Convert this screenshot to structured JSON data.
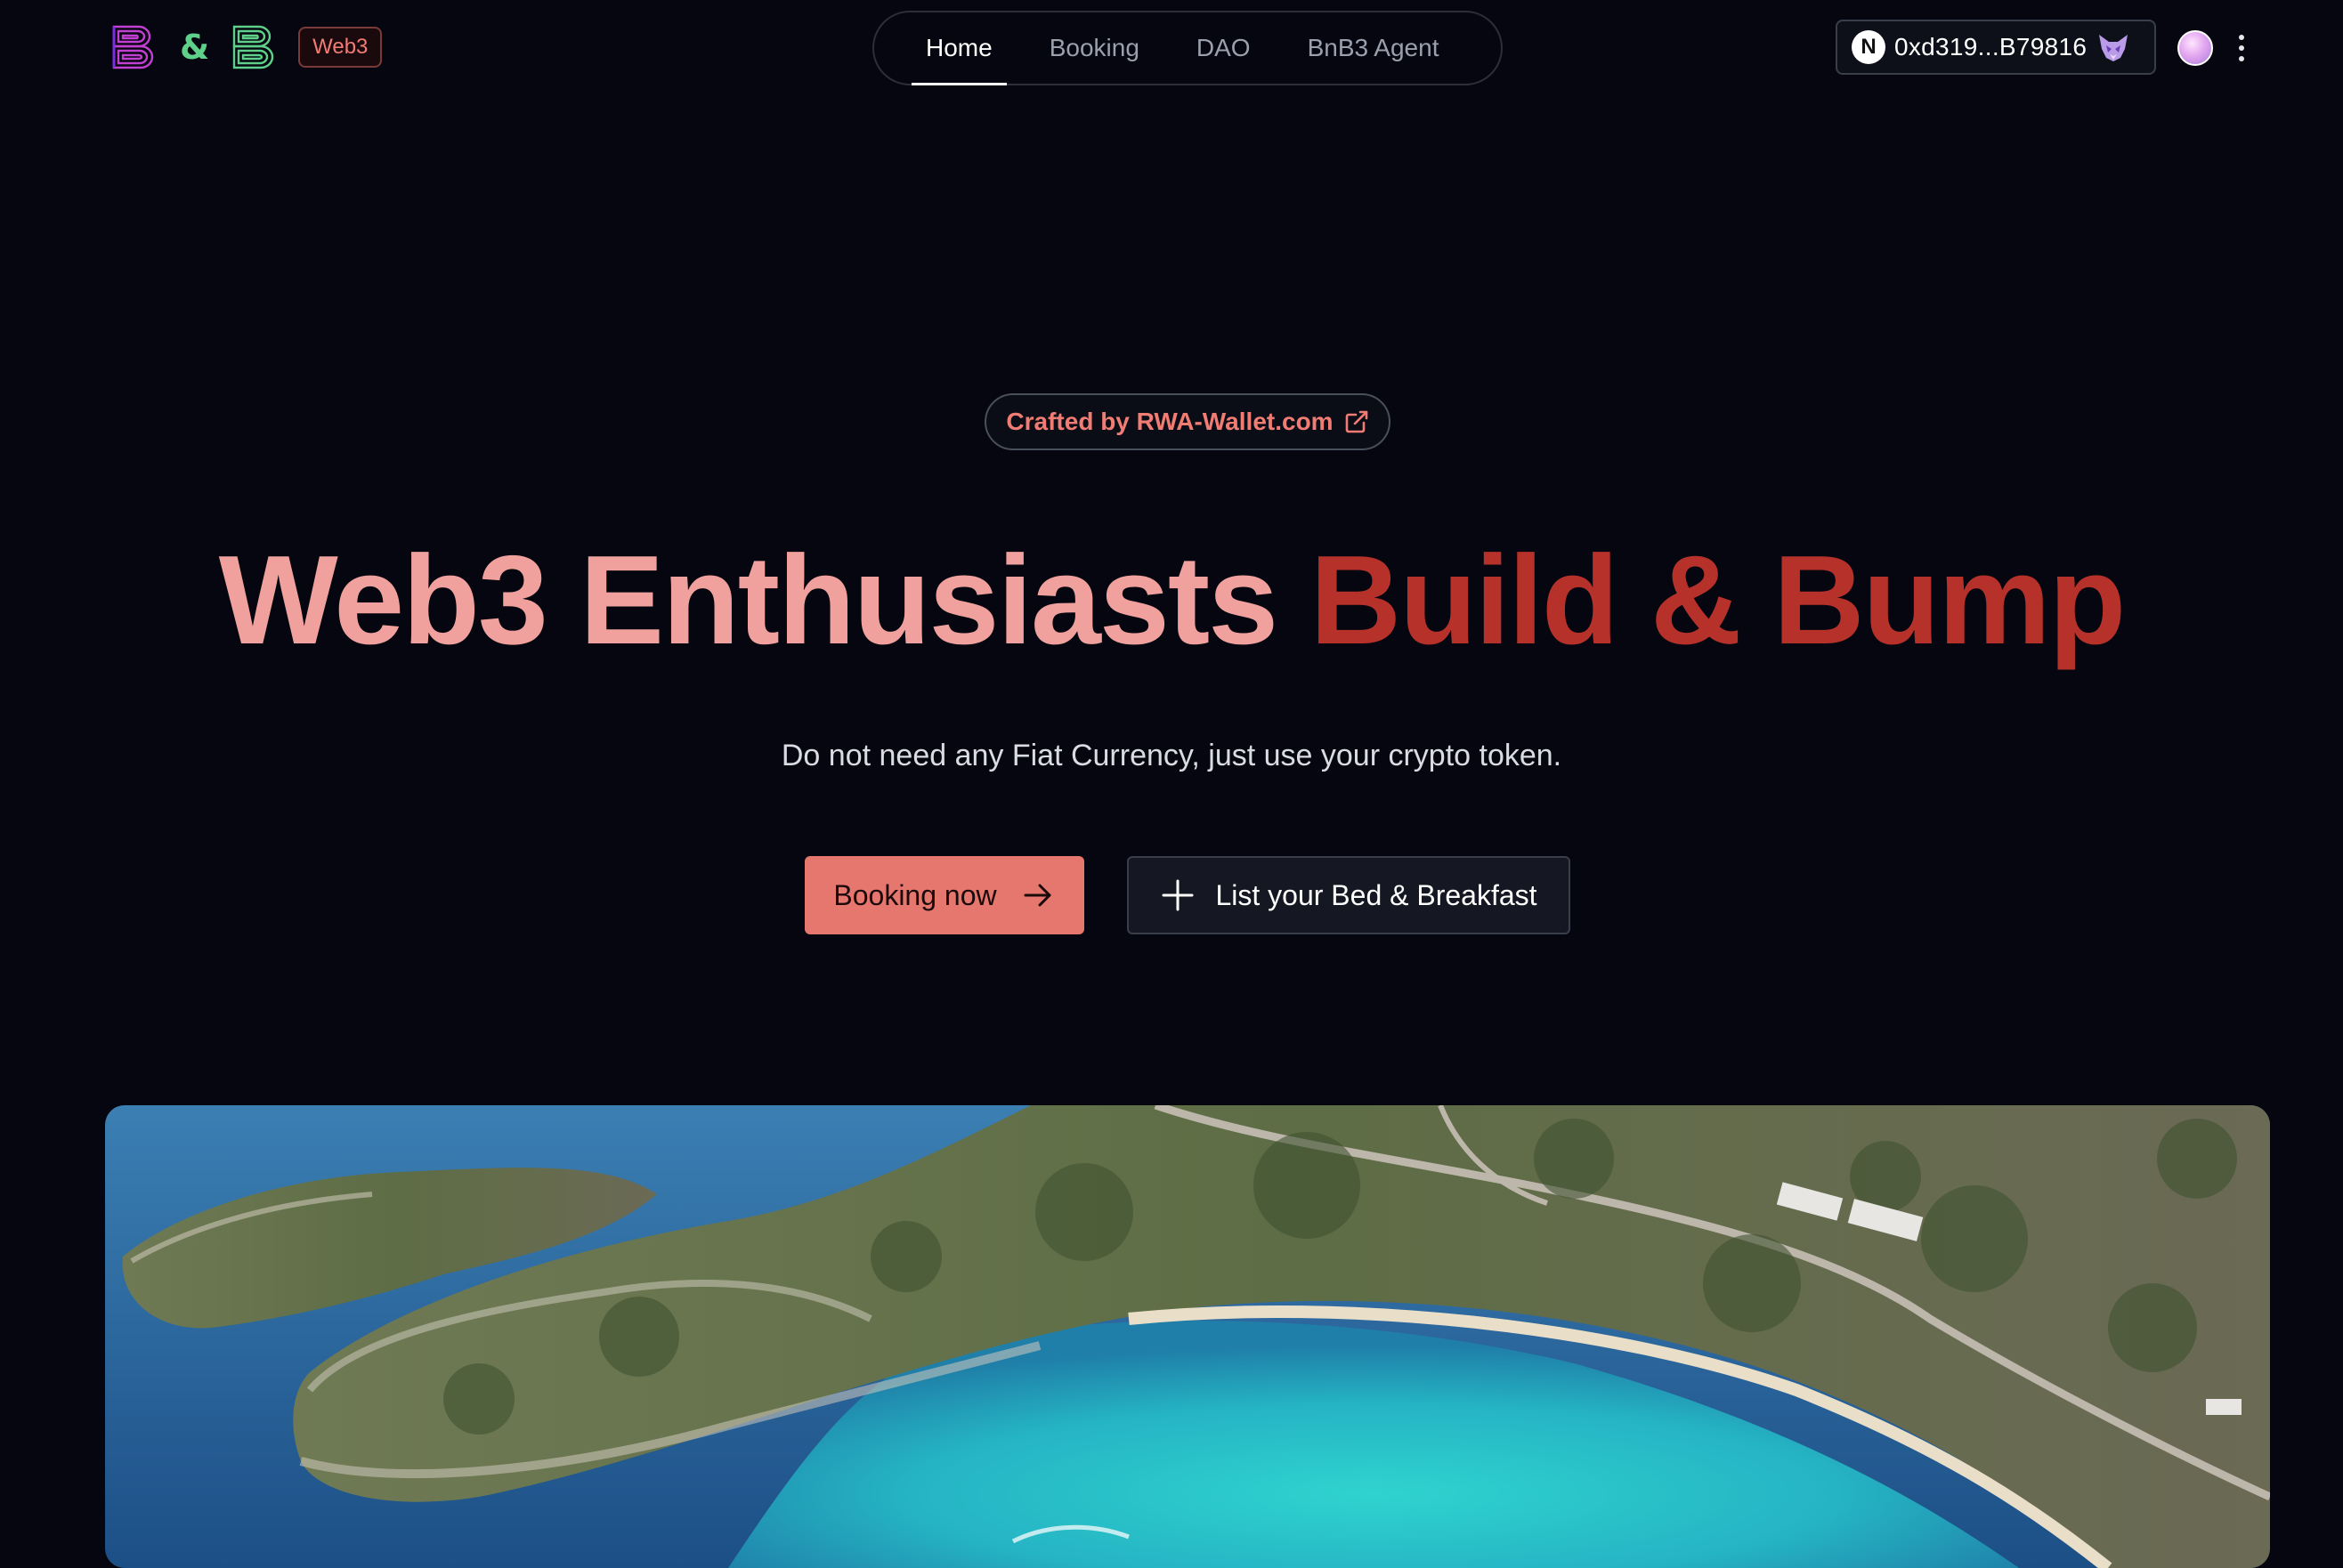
{
  "header": {
    "logo": {
      "left_letter": "B",
      "ampersand": "&",
      "right_letter": "B",
      "badge": "Web3"
    },
    "nav": [
      {
        "label": "Home",
        "active": true
      },
      {
        "label": "Booking",
        "active": false
      },
      {
        "label": "DAO",
        "active": false
      },
      {
        "label": "BnB3 Agent",
        "active": false
      }
    ],
    "wallet": {
      "network_letter": "N",
      "address": "0xd319...B79816",
      "wallet_icon": "fox-icon"
    },
    "avatar_icon": "avatar",
    "menu_icon": "kebab-menu-icon"
  },
  "hero": {
    "crafted_by": "Crafted by RWA-Wallet.com",
    "crafted_icon": "external-link-icon",
    "headline_part1": "Web3 Enthusiasts",
    "headline_part2": "Build & Bump",
    "subtitle": "Do not need any Fiat Currency, just use your crypto token.",
    "primary_button": "Booking now",
    "primary_icon": "arrow-right-icon",
    "secondary_button": "List your Bed & Breakfast",
    "secondary_icon": "plus-icon",
    "image_subject": "aerial-coastline-photo"
  },
  "colors": {
    "background": "#05060f",
    "accent": "#e5776e",
    "headline_light": "#f0a19e",
    "headline_dark": "#b7312b",
    "logo_pink": "#c23fd1",
    "logo_green": "#5fd08a"
  }
}
